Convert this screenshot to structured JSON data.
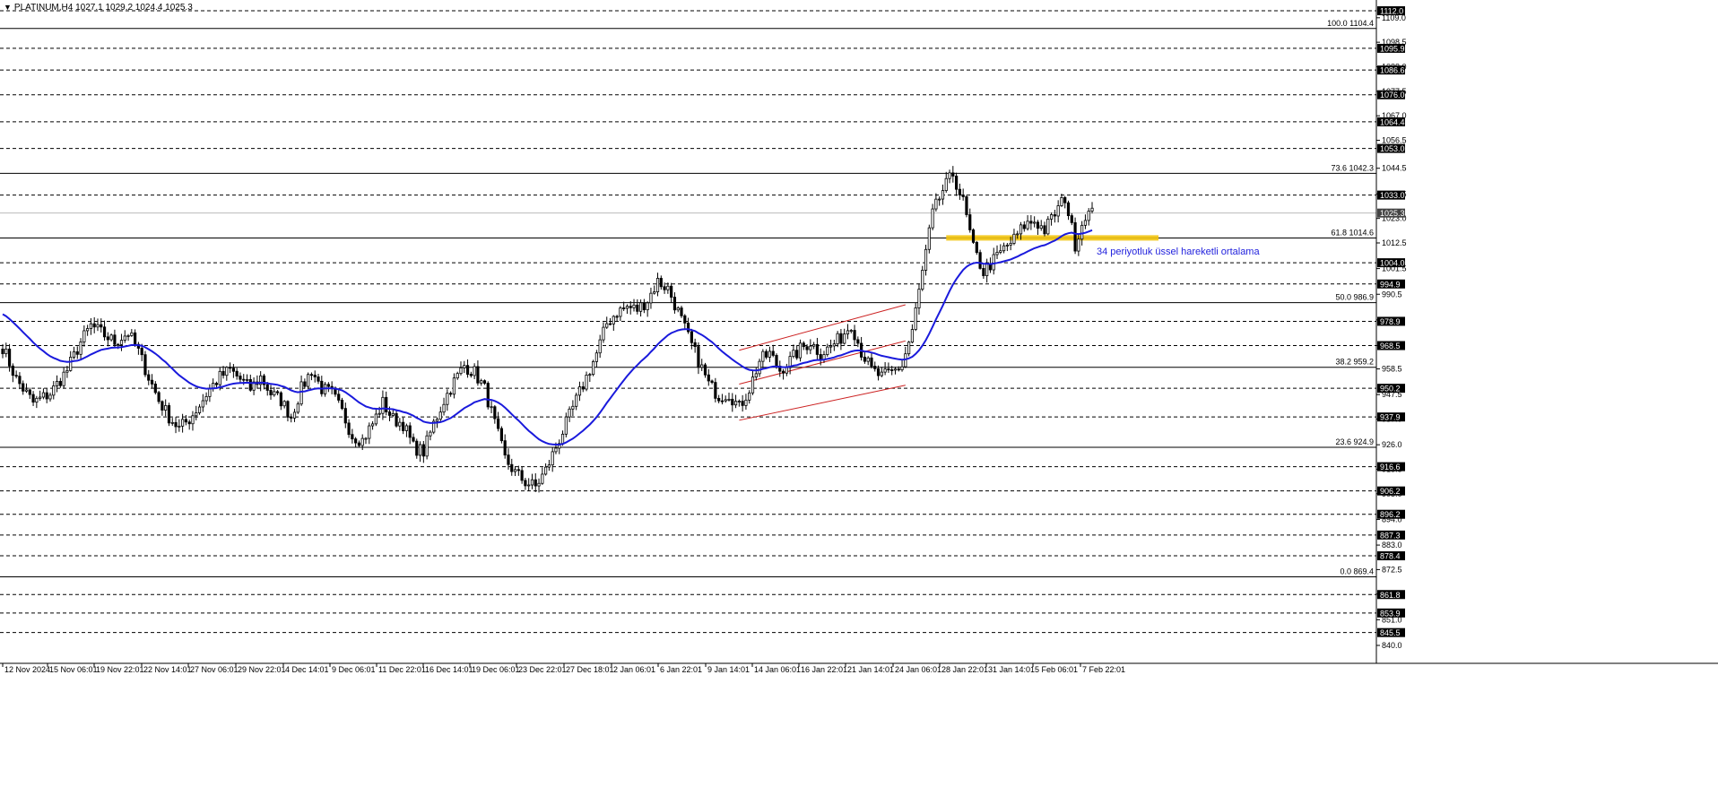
{
  "header": {
    "symbol_line": "PLATINUM,H4  1027.1 1029.2 1024.4 1025.3",
    "menu_icon": "triangle-down-icon"
  },
  "chart_data": {
    "type": "candlestick",
    "symbol": "PLATINUM",
    "timeframe": "H4",
    "ohlc_header": {
      "open": 1027.1,
      "high": 1029.2,
      "low": 1024.4,
      "close": 1025.3
    },
    "current_price": 1025.3,
    "ylim": [
      840.0,
      1112.0
    ],
    "y_ticks": [
      "1109.0",
      "1098.5",
      "1088.0",
      "1077.5",
      "1067.0",
      "1056.5",
      "1044.5",
      "1033.5",
      "1023.0",
      "1012.5",
      "1001.5",
      "990.5",
      "979.5",
      "968.5",
      "958.5",
      "947.5",
      "937.0",
      "926.0",
      "915.5",
      "905.0",
      "894.0",
      "883.0",
      "872.5",
      "862.0",
      "851.0",
      "840.0"
    ],
    "price_level_labels": [
      "1112.0",
      "1095.9",
      "1086.6",
      "1076.0",
      "1064.4",
      "1053.0",
      "1033.0",
      "1025.3",
      "1004.0",
      "994.9",
      "978.9",
      "968.5",
      "950.2",
      "937.9",
      "916.6",
      "906.2",
      "896.2",
      "887.3",
      "878.4",
      "861.8",
      "853.9",
      "845.5"
    ],
    "horizontal_levels": [
      1112.0,
      1095.9,
      1086.6,
      1076.0,
      1064.4,
      1053.0,
      1033.0,
      1004.0,
      994.9,
      978.9,
      968.5,
      950.2,
      937.9,
      916.6,
      906.2,
      896.2,
      887.3,
      878.4,
      861.8,
      853.9,
      845.5
    ],
    "fibonacci": {
      "levels": [
        {
          "label": "100.0 1104.4",
          "value": 1104.4
        },
        {
          "label": "73.6 1042.3",
          "value": 1042.3
        },
        {
          "label": "61.8 1014.6",
          "value": 1014.6
        },
        {
          "label": "50.0 986.9",
          "value": 986.9
        },
        {
          "label": "38.2 959.2",
          "value": 959.2
        },
        {
          "label": "23.6 924.9",
          "value": 924.9
        },
        {
          "label": "0.0 869.4",
          "value": 869.4
        }
      ]
    },
    "x_labels": [
      "12 Nov 2024",
      "15 Nov 06:01",
      "19 Nov 22:01",
      "22 Nov 14:01",
      "27 Nov 06:01",
      "29 Nov 22:01",
      "4 Dec 14:01",
      "9 Dec 06:01",
      "11 Dec 22:01",
      "16 Dec 14:01",
      "19 Dec 06:01",
      "23 Dec 22:01",
      "27 Dec 18:01",
      "2 Jan 06:01",
      "6 Jan 22:01",
      "9 Jan 14:01",
      "14 Jan 06:01",
      "16 Jan 22:01",
      "21 Jan 14:01",
      "24 Jan 06:01",
      "28 Jan 22:01",
      "31 Jan 14:01",
      "5 Feb 06:01",
      "7 Feb 22:01"
    ],
    "annotation": "34 periyotluk üssel hareketli ortalama",
    "ema_period": 34,
    "ema_color": "#1a1adc",
    "channel_color": "#cc2222",
    "support_zone": {
      "from": 1013.5,
      "to": 1015.8,
      "color": "#f2c40f"
    },
    "close_path": [
      {
        "i": 0,
        "c": 968
      },
      {
        "i": 4,
        "c": 954
      },
      {
        "i": 9,
        "c": 944
      },
      {
        "i": 14,
        "c": 948
      },
      {
        "i": 19,
        "c": 958
      },
      {
        "i": 23,
        "c": 970
      },
      {
        "i": 26,
        "c": 977
      },
      {
        "i": 29,
        "c": 974
      },
      {
        "i": 33,
        "c": 970
      },
      {
        "i": 37,
        "c": 974
      },
      {
        "i": 40,
        "c": 966
      },
      {
        "i": 43,
        "c": 955
      },
      {
        "i": 46,
        "c": 945
      },
      {
        "i": 49,
        "c": 938
      },
      {
        "i": 52,
        "c": 933
      },
      {
        "i": 55,
        "c": 937
      },
      {
        "i": 58,
        "c": 943
      },
      {
        "i": 61,
        "c": 950
      },
      {
        "i": 64,
        "c": 955
      },
      {
        "i": 67,
        "c": 958
      },
      {
        "i": 70,
        "c": 954
      },
      {
        "i": 73,
        "c": 950
      },
      {
        "i": 76,
        "c": 955
      },
      {
        "i": 79,
        "c": 948
      },
      {
        "i": 82,
        "c": 945
      },
      {
        "i": 85,
        "c": 938
      },
      {
        "i": 88,
        "c": 950
      },
      {
        "i": 91,
        "c": 958
      },
      {
        "i": 94,
        "c": 950
      },
      {
        "i": 97,
        "c": 948
      },
      {
        "i": 100,
        "c": 940
      },
      {
        "i": 103,
        "c": 930
      },
      {
        "i": 106,
        "c": 928
      },
      {
        "i": 109,
        "c": 935
      },
      {
        "i": 112,
        "c": 944
      },
      {
        "i": 115,
        "c": 937
      },
      {
        "i": 118,
        "c": 935
      },
      {
        "i": 121,
        "c": 925
      },
      {
        "i": 124,
        "c": 923
      },
      {
        "i": 127,
        "c": 935
      },
      {
        "i": 130,
        "c": 945
      },
      {
        "i": 133,
        "c": 953
      },
      {
        "i": 136,
        "c": 960
      },
      {
        "i": 139,
        "c": 957
      },
      {
        "i": 142,
        "c": 950
      },
      {
        "i": 145,
        "c": 935
      },
      {
        "i": 148,
        "c": 920
      },
      {
        "i": 151,
        "c": 914
      },
      {
        "i": 154,
        "c": 910
      },
      {
        "i": 157,
        "c": 908
      },
      {
        "i": 160,
        "c": 915
      },
      {
        "i": 163,
        "c": 925
      },
      {
        "i": 166,
        "c": 935
      },
      {
        "i": 169,
        "c": 945
      },
      {
        "i": 172,
        "c": 955
      },
      {
        "i": 175,
        "c": 965
      },
      {
        "i": 178,
        "c": 978
      },
      {
        "i": 181,
        "c": 983
      },
      {
        "i": 184,
        "c": 985
      },
      {
        "i": 187,
        "c": 984
      },
      {
        "i": 190,
        "c": 988
      },
      {
        "i": 193,
        "c": 996
      },
      {
        "i": 196,
        "c": 993
      },
      {
        "i": 199,
        "c": 983
      },
      {
        "i": 202,
        "c": 972
      },
      {
        "i": 205,
        "c": 962
      },
      {
        "i": 208,
        "c": 952
      },
      {
        "i": 211,
        "c": 947
      },
      {
        "i": 214,
        "c": 948
      },
      {
        "i": 217,
        "c": 942
      },
      {
        "i": 220,
        "c": 950
      },
      {
        "i": 223,
        "c": 962
      },
      {
        "i": 226,
        "c": 965
      },
      {
        "i": 229,
        "c": 958
      },
      {
        "i": 232,
        "c": 962
      },
      {
        "i": 235,
        "c": 967
      },
      {
        "i": 238,
        "c": 970
      },
      {
        "i": 241,
        "c": 965
      },
      {
        "i": 244,
        "c": 968
      },
      {
        "i": 247,
        "c": 972
      },
      {
        "i": 250,
        "c": 978
      },
      {
        "i": 253,
        "c": 966
      },
      {
        "i": 256,
        "c": 958
      },
      {
        "i": 259,
        "c": 955
      },
      {
        "i": 262,
        "c": 957
      },
      {
        "i": 265,
        "c": 960
      },
      {
        "i": 268,
        "c": 975
      },
      {
        "i": 271,
        "c": 1000
      },
      {
        "i": 274,
        "c": 1025
      },
      {
        "i": 277,
        "c": 1035
      },
      {
        "i": 280,
        "c": 1042
      },
      {
        "i": 283,
        "c": 1030
      },
      {
        "i": 286,
        "c": 1010
      },
      {
        "i": 289,
        "c": 1000
      },
      {
        "i": 292,
        "c": 1005
      },
      {
        "i": 295,
        "c": 1010
      },
      {
        "i": 298,
        "c": 1014
      },
      {
        "i": 301,
        "c": 1020
      },
      {
        "i": 304,
        "c": 1022
      },
      {
        "i": 307,
        "c": 1018
      },
      {
        "i": 310,
        "c": 1025
      },
      {
        "i": 313,
        "c": 1032
      },
      {
        "i": 316,
        "c": 1012
      },
      {
        "i": 319,
        "c": 1025
      }
    ]
  }
}
